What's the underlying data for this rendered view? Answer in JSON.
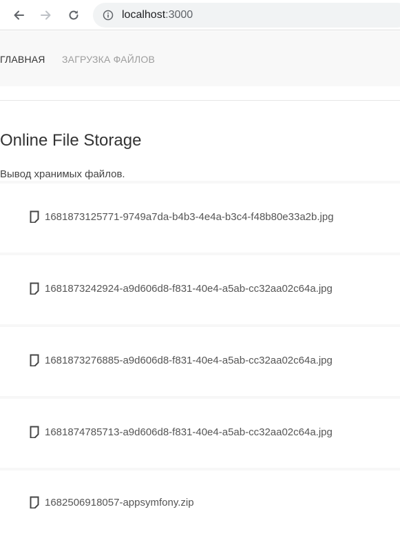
{
  "browser": {
    "url_host": "localhost",
    "url_port": ":3000"
  },
  "nav": {
    "home": "ГЛАВНАЯ",
    "upload": "ЗАГРУЗКА ФАЙЛОВ"
  },
  "page": {
    "title": "Online File Storage",
    "subtitle": "Вывод хранимых файлов."
  },
  "files": [
    {
      "name": "1681873125771-9749a7da-b4b3-4e4a-b3c4-f48b80e33a2b.jpg"
    },
    {
      "name": "1681873242924-a9d606d8-f831-40e4-a5ab-cc32aa02c64a.jpg"
    },
    {
      "name": "1681873276885-a9d606d8-f831-40e4-a5ab-cc32aa02c64a.jpg"
    },
    {
      "name": "1681874785713-a9d606d8-f831-40e4-a5ab-cc32aa02c64a.jpg"
    },
    {
      "name": "1682506918057-appsymfony.zip"
    }
  ]
}
